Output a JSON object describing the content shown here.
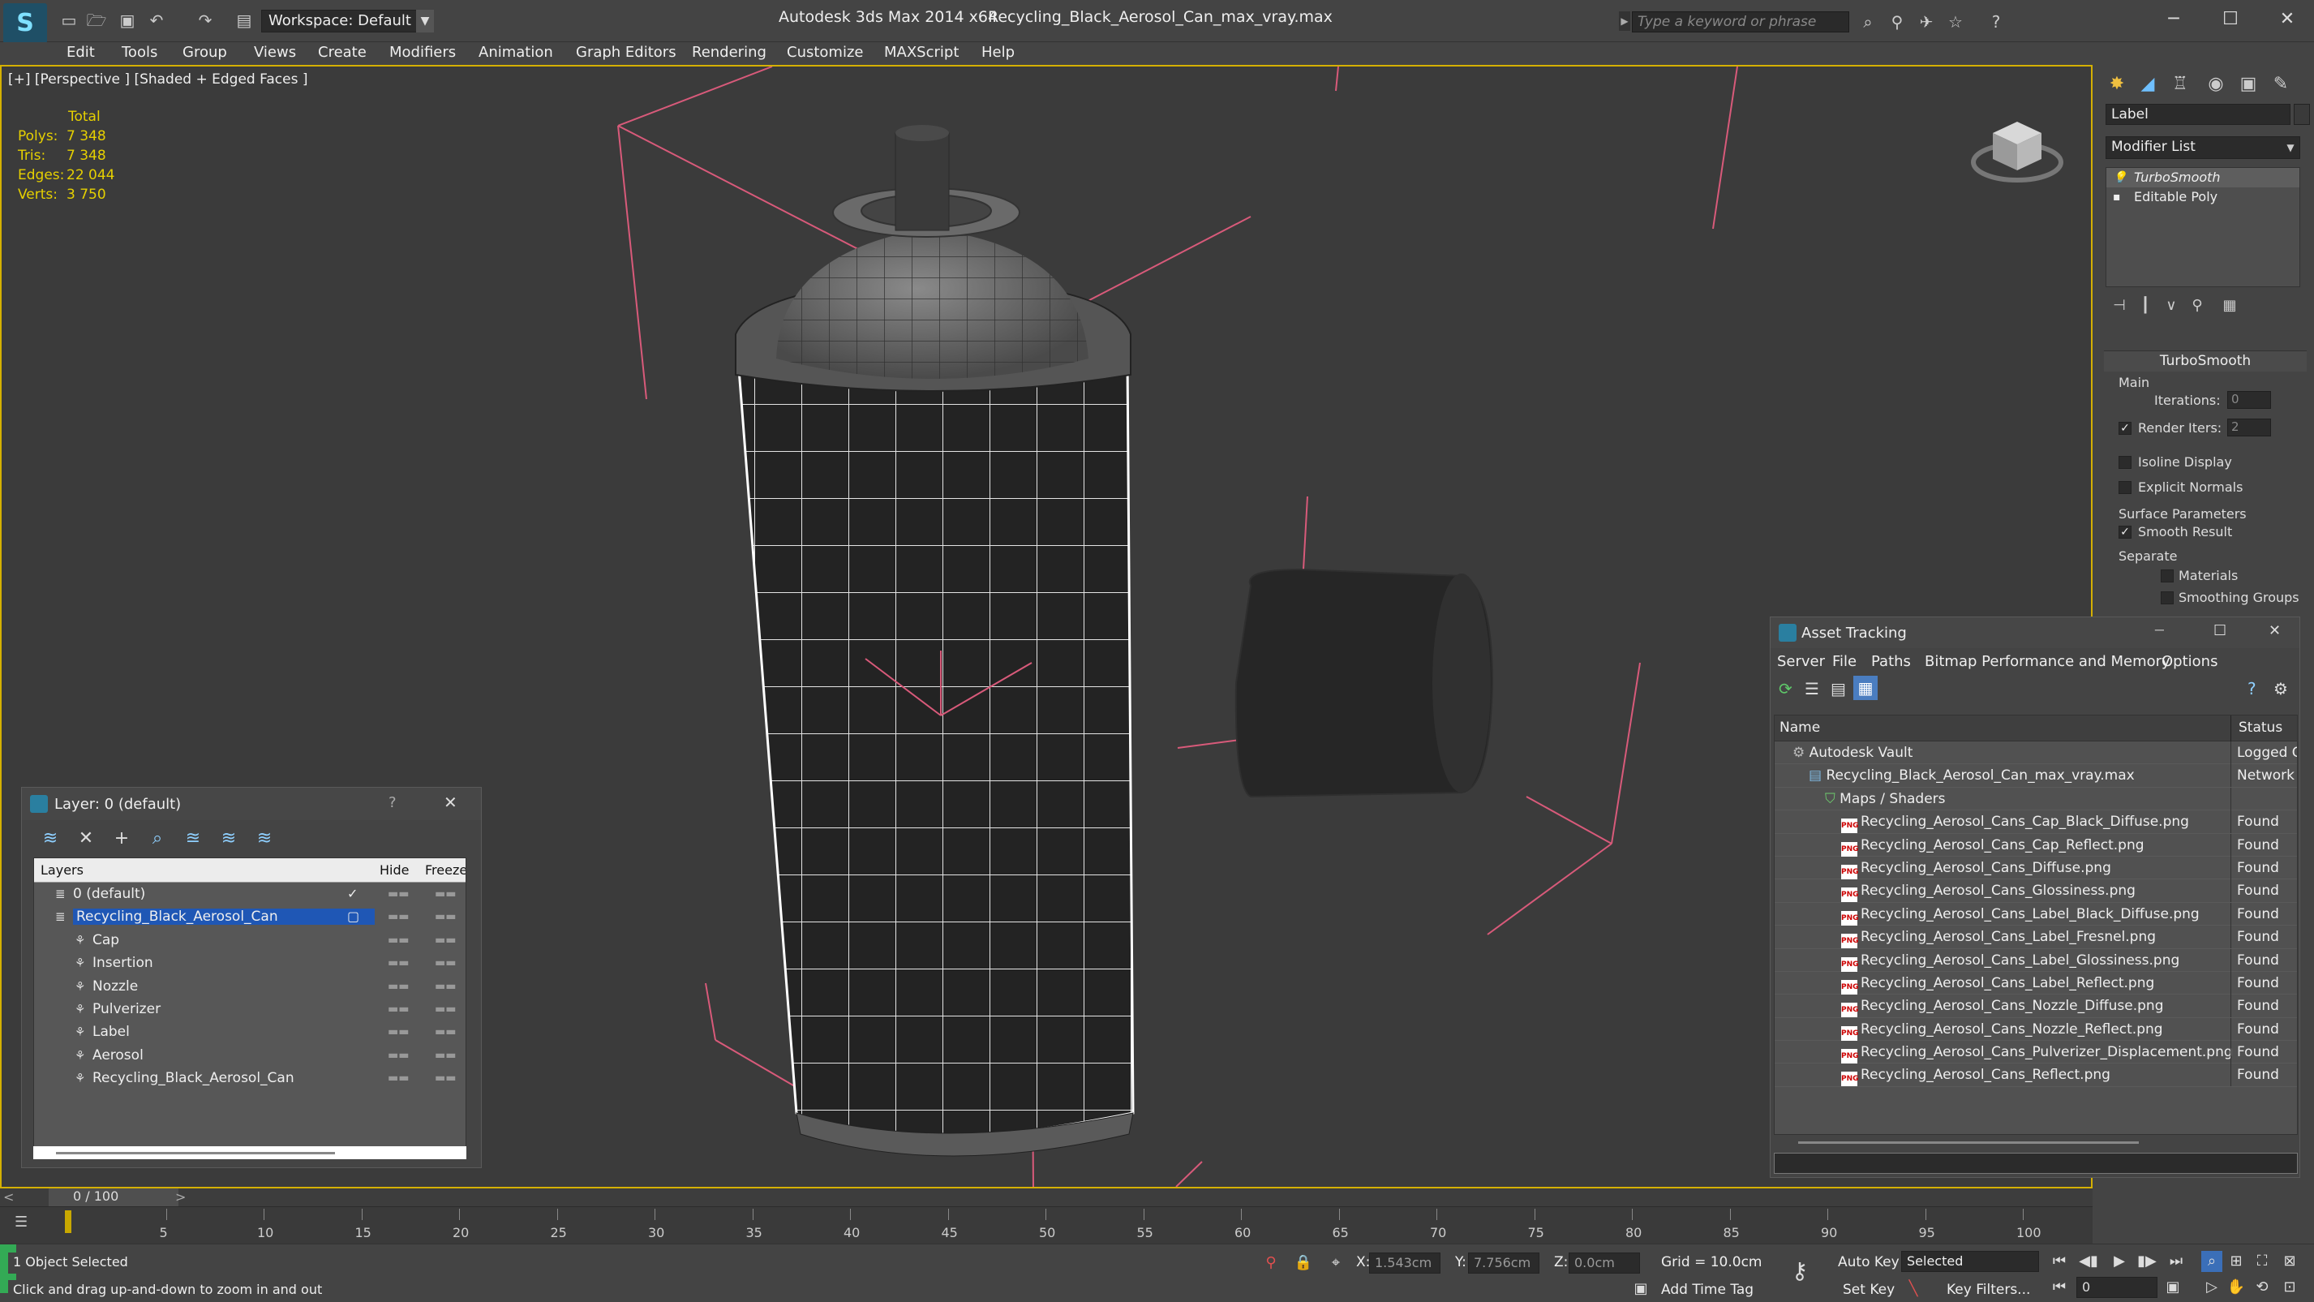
{
  "title_bar": {
    "app_name": "Autodesk 3ds Max  2014 x64",
    "file_name": "Recycling_Black_Aerosol_Can_max_vray.max",
    "workspace": "Workspace: Default",
    "search_placeholder": "Type a keyword or phrase"
  },
  "menu": [
    "Edit",
    "Tools",
    "Group",
    "Views",
    "Create",
    "Modifiers",
    "Animation",
    "Graph Editors",
    "Rendering",
    "Customize",
    "MAXScript",
    "Help"
  ],
  "viewport": {
    "label": "[+] [Perspective ] [Shaded + Edged Faces ]",
    "stats": {
      "header": "Total",
      "rows": [
        {
          "k": "Polys:",
          "v": "7 348"
        },
        {
          "k": "Tris:",
          "v": "7 348"
        },
        {
          "k": "Edges:",
          "v": "22 044"
        },
        {
          "k": "Verts:",
          "v": "3 750"
        }
      ]
    }
  },
  "command_panel": {
    "label_field": "Label",
    "modifier_list": "Modifier List",
    "stack": [
      {
        "name": "TurboSmooth",
        "selected": true
      },
      {
        "name": "Editable Poly",
        "selected": false
      }
    ],
    "rollout_title": "TurboSmooth",
    "main_group": "Main",
    "iterations_label": "Iterations:",
    "iterations_value": "0",
    "render_iters_label": "Render Iters:",
    "render_iters_value": "2",
    "isoline_label": "Isoline Display",
    "explicit_label": "Explicit Normals",
    "surface_group": "Surface Parameters",
    "smooth_result_label": "Smooth Result",
    "separate_label": "Separate",
    "materials_label": "Materials",
    "smoothing_groups_label": "Smoothing Groups"
  },
  "asset_tracking": {
    "title": "Asset Tracking",
    "menu": [
      "Server",
      "File",
      "Paths",
      "Bitmap Performance and Memory",
      "Options"
    ],
    "col_name": "Name",
    "col_status": "Status",
    "rows": [
      {
        "name": "Autodesk Vault",
        "status": "Logged O",
        "indent": 0,
        "icon": "vault"
      },
      {
        "name": "Recycling_Black_Aerosol_Can_max_vray.max",
        "status": "Network",
        "indent": 1,
        "icon": "max"
      },
      {
        "name": "Maps / Shaders",
        "status": "",
        "indent": 2,
        "icon": "folder"
      },
      {
        "name": "Recycling_Aerosol_Cans_Cap_Black_Diffuse.png",
        "status": "Found",
        "indent": 3,
        "icon": "png"
      },
      {
        "name": "Recycling_Aerosol_Cans_Cap_Reflect.png",
        "status": "Found",
        "indent": 3,
        "icon": "png"
      },
      {
        "name": "Recycling_Aerosol_Cans_Diffuse.png",
        "status": "Found",
        "indent": 3,
        "icon": "png"
      },
      {
        "name": "Recycling_Aerosol_Cans_Glossiness.png",
        "status": "Found",
        "indent": 3,
        "icon": "png"
      },
      {
        "name": "Recycling_Aerosol_Cans_Label_Black_Diffuse.png",
        "status": "Found",
        "indent": 3,
        "icon": "png"
      },
      {
        "name": "Recycling_Aerosol_Cans_Label_Fresnel.png",
        "status": "Found",
        "indent": 3,
        "icon": "png"
      },
      {
        "name": "Recycling_Aerosol_Cans_Label_Glossiness.png",
        "status": "Found",
        "indent": 3,
        "icon": "png"
      },
      {
        "name": "Recycling_Aerosol_Cans_Label_Reflect.png",
        "status": "Found",
        "indent": 3,
        "icon": "png"
      },
      {
        "name": "Recycling_Aerosol_Cans_Nozzle_Diffuse.png",
        "status": "Found",
        "indent": 3,
        "icon": "png"
      },
      {
        "name": "Recycling_Aerosol_Cans_Nozzle_Reflect.png",
        "status": "Found",
        "indent": 3,
        "icon": "png"
      },
      {
        "name": "Recycling_Aerosol_Cans_Pulverizer_Displacement.png",
        "status": "Found",
        "indent": 3,
        "icon": "png"
      },
      {
        "name": "Recycling_Aerosol_Cans_Reflect.png",
        "status": "Found",
        "indent": 3,
        "icon": "png"
      }
    ]
  },
  "layer_window": {
    "title": "Layer: 0 (default)",
    "help": "?",
    "col_layers": "Layers",
    "col_hide": "Hide",
    "col_freeze": "Freeze",
    "rows": [
      {
        "name": "0 (default)",
        "indent": 0,
        "selected": false,
        "check": "✓"
      },
      {
        "name": "Recycling_Black_Aerosol_Can",
        "indent": 0,
        "selected": true,
        "check": "▢"
      },
      {
        "name": "Cap",
        "indent": 1,
        "selected": false,
        "check": ""
      },
      {
        "name": "Insertion",
        "indent": 1,
        "selected": false,
        "check": ""
      },
      {
        "name": "Nozzle",
        "indent": 1,
        "selected": false,
        "check": ""
      },
      {
        "name": "Pulverizer",
        "indent": 1,
        "selected": false,
        "check": ""
      },
      {
        "name": "Label",
        "indent": 1,
        "selected": false,
        "check": ""
      },
      {
        "name": "Aerosol",
        "indent": 1,
        "selected": false,
        "check": ""
      },
      {
        "name": "Recycling_Black_Aerosol_Can",
        "indent": 1,
        "selected": false,
        "check": ""
      }
    ]
  },
  "timeline": {
    "slider": "0 / 100",
    "ticks": [
      "5",
      "10",
      "15",
      "20",
      "25",
      "30",
      "35",
      "40",
      "45",
      "50",
      "55",
      "60",
      "65",
      "70",
      "75",
      "80",
      "85",
      "90",
      "95",
      "100"
    ]
  },
  "status": {
    "selection": "1 Object Selected",
    "hint": "Click and drag up-and-down to zoom in and out",
    "x_label": "X:",
    "x_value": "1.543cm",
    "y_label": "Y:",
    "y_value": "7.756cm",
    "z_label": "Z:",
    "z_value": "0.0cm",
    "grid": "Grid = 10.0cm",
    "add_time_tag": "Add Time Tag",
    "auto_key": "Auto Key",
    "set_key": "Set Key",
    "selected_dd": "Selected",
    "key_filters": "Key Filters...",
    "frame": "0"
  },
  "colors": {
    "viewport_border": "#d4b000",
    "stats_text": "#e6d000",
    "layer_selection": "#1f57b5",
    "gizmo_lines": "#d85a7a"
  }
}
